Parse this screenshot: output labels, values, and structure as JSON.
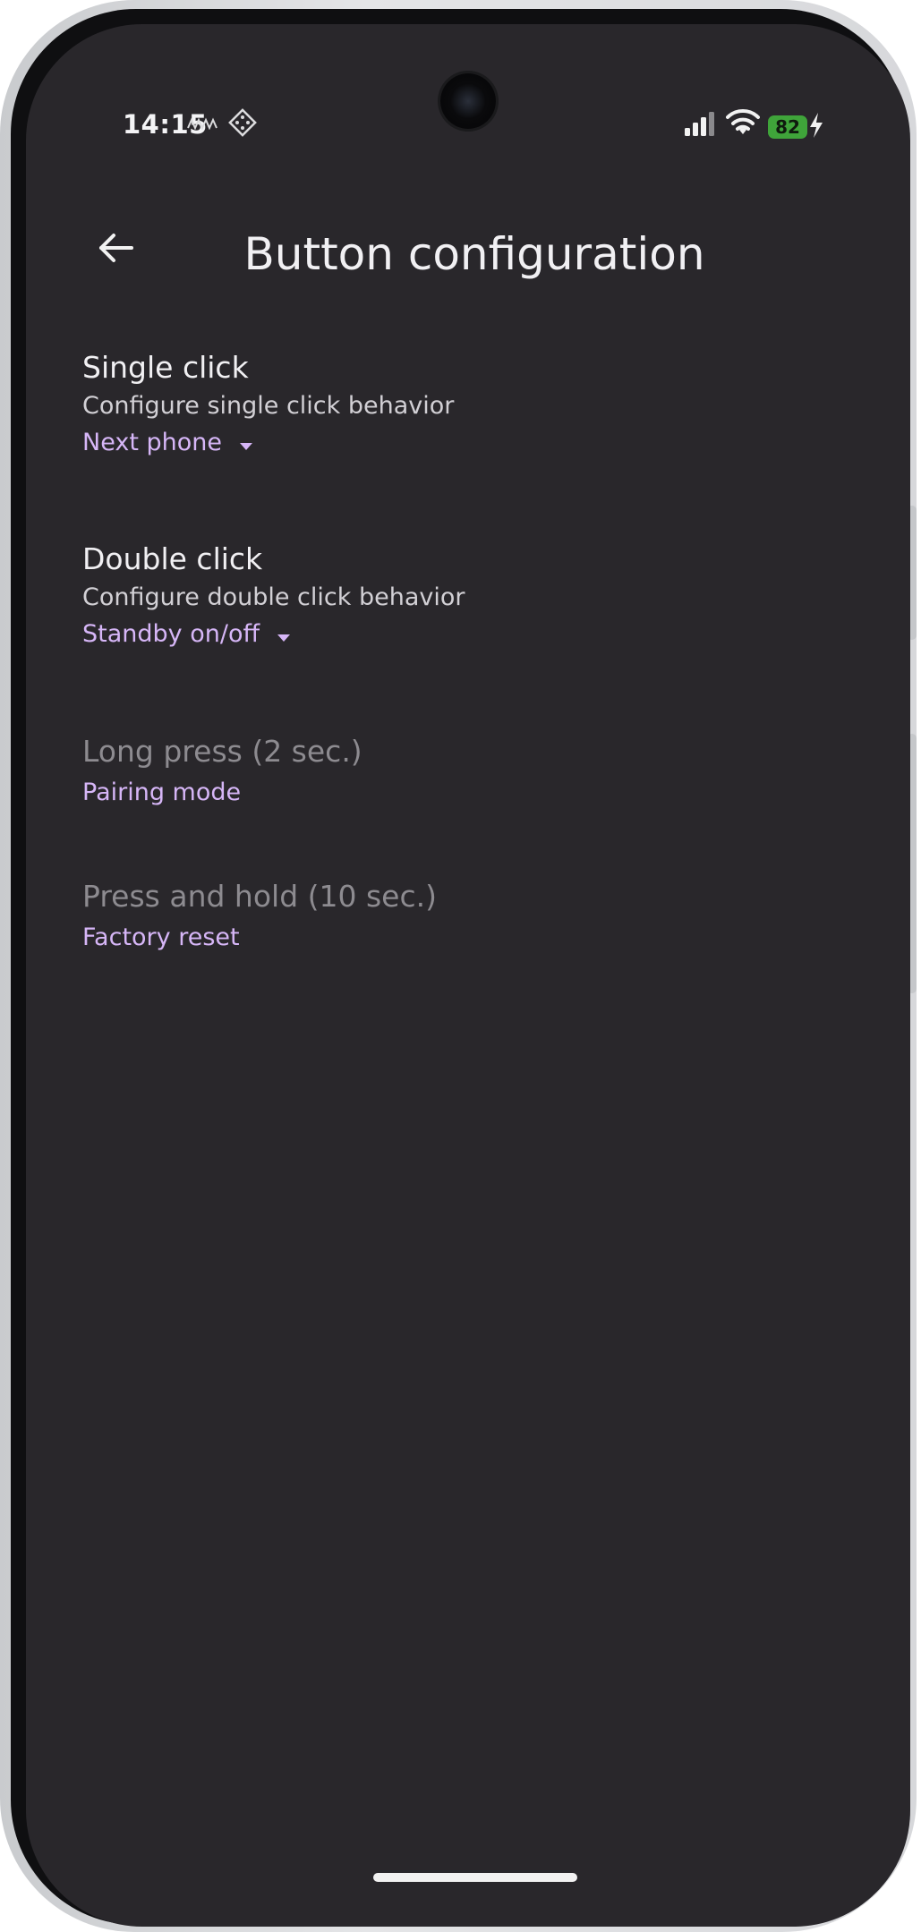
{
  "status_bar": {
    "time": "14:15",
    "battery_level": "82",
    "icons": [
      "signal-wave-icon",
      "diamond-grid-icon",
      "cellular-signal-icon",
      "wifi-icon",
      "battery-icon",
      "charging-bolt-icon"
    ]
  },
  "app_bar": {
    "title": "Button configuration",
    "back_icon": "arrow-left-icon"
  },
  "settings": {
    "single_click": {
      "title": "Single click",
      "description": "Configure single click behavior",
      "value": "Next phone"
    },
    "double_click": {
      "title": "Double click",
      "description": "Configure double click behavior",
      "value": "Standby on/off"
    },
    "long_press": {
      "title": "Long press (2 sec.)",
      "value": "Pairing mode"
    },
    "press_hold": {
      "title": "Press and hold (10 sec.)",
      "value": "Factory reset"
    }
  },
  "colors": {
    "background": "#29272b",
    "accent": "#d6b6f7",
    "text_primary": "#f1f0f3",
    "text_disabled": "#8d8b90",
    "battery": "#3fa43a"
  }
}
